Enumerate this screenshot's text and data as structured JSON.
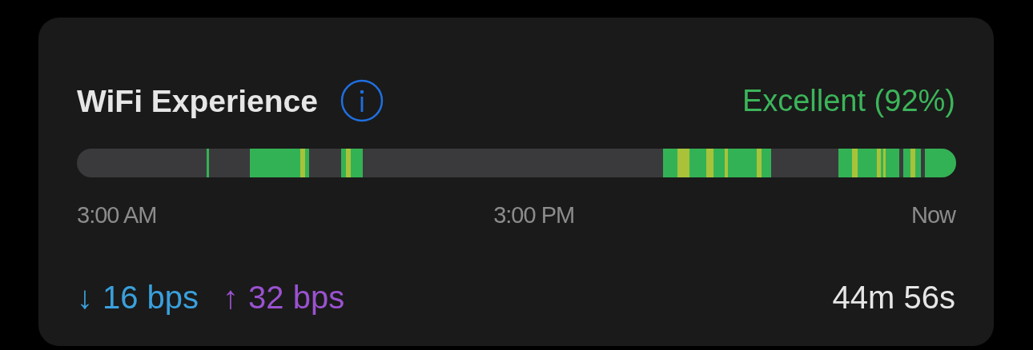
{
  "card": {
    "title": "WiFi Experience",
    "rating": "Excellent (92%)",
    "timeline": {
      "axis_labels": [
        "3:00 AM",
        "3:00 PM",
        "Now"
      ]
    },
    "download": {
      "arrow": "↓",
      "speed": "16 bps"
    },
    "upload": {
      "arrow": "↑",
      "speed": "32 bps"
    },
    "duration": "44m 56s"
  }
}
